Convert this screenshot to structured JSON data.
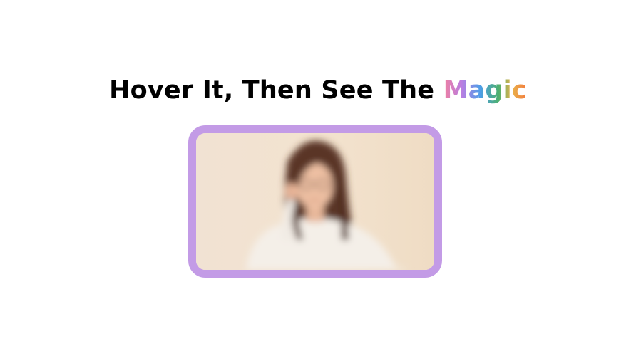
{
  "heading": {
    "prefix": "Hover It, Then See The ",
    "highlight": "Magic"
  },
  "card": {
    "image_subject": "woman-with-glasses-photo",
    "image_state": "blurred",
    "border_color": "#c39be6",
    "magic_gradient": [
      "#f07fa0",
      "#b97ee2",
      "#4e9ee8",
      "#4db06f",
      "#e8b24a",
      "#f47b3e"
    ]
  }
}
